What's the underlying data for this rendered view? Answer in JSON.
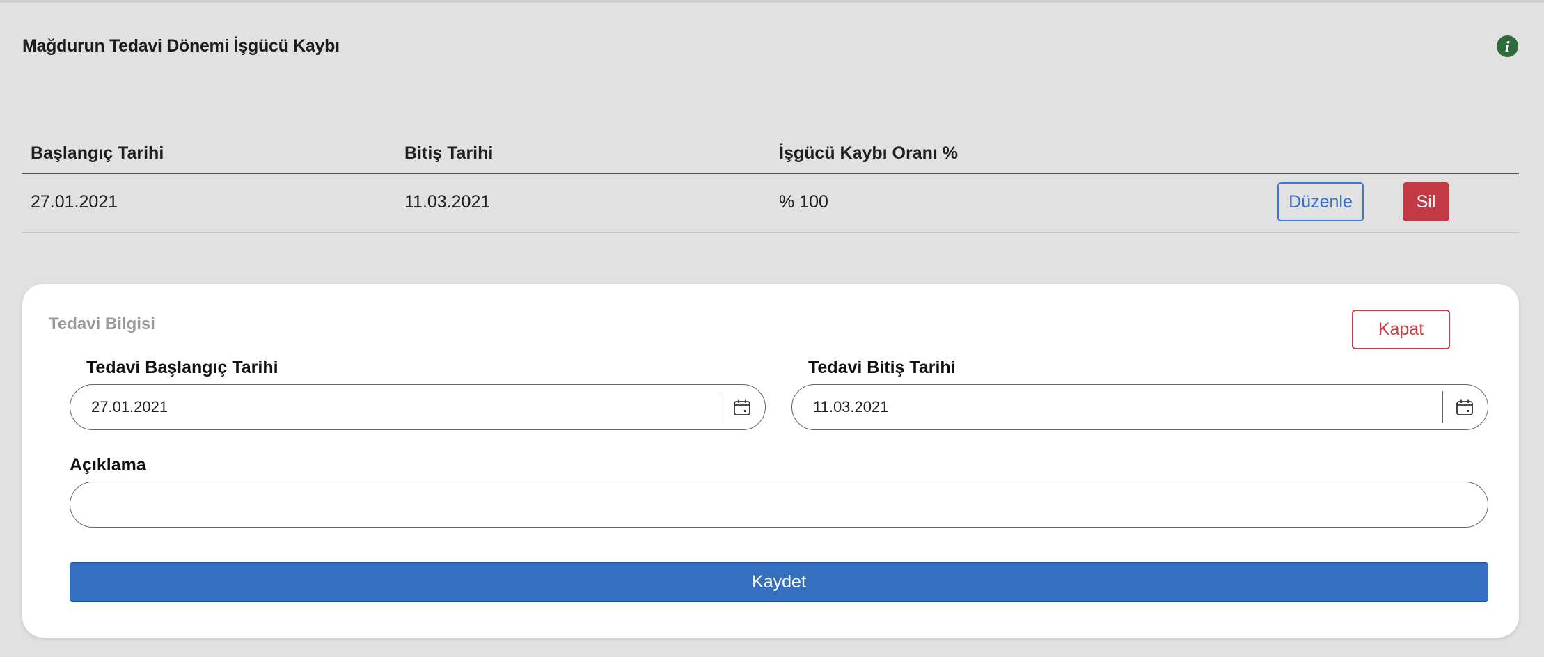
{
  "section": {
    "title": "Mağdurun Tedavi Dönemi İşgücü Kaybı",
    "info_icon": "info-icon",
    "info_icon_glyph": "i"
  },
  "table": {
    "headers": [
      "Başlangıç Tarihi",
      "Bitiş Tarihi",
      "İşgücü Kaybı Oranı %"
    ],
    "rows": [
      {
        "start": "27.01.2021",
        "end": "11.03.2021",
        "rate": "% 100",
        "edit_label": "Düzenle",
        "delete_label": "Sil"
      }
    ]
  },
  "form": {
    "title": "Tedavi Bilgisi",
    "close_label": "Kapat",
    "start_label": "Tedavi Başlangıç Tarihi",
    "start_value": "27.01.2021",
    "end_label": "Tedavi Bitiş Tarihi",
    "end_value": "11.03.2021",
    "description_label": "Açıklama",
    "description_value": "",
    "save_label": "Kaydet"
  },
  "colors": {
    "primary": "#356fc0",
    "danger": "#c23a45",
    "info": "#2f6b3a"
  }
}
